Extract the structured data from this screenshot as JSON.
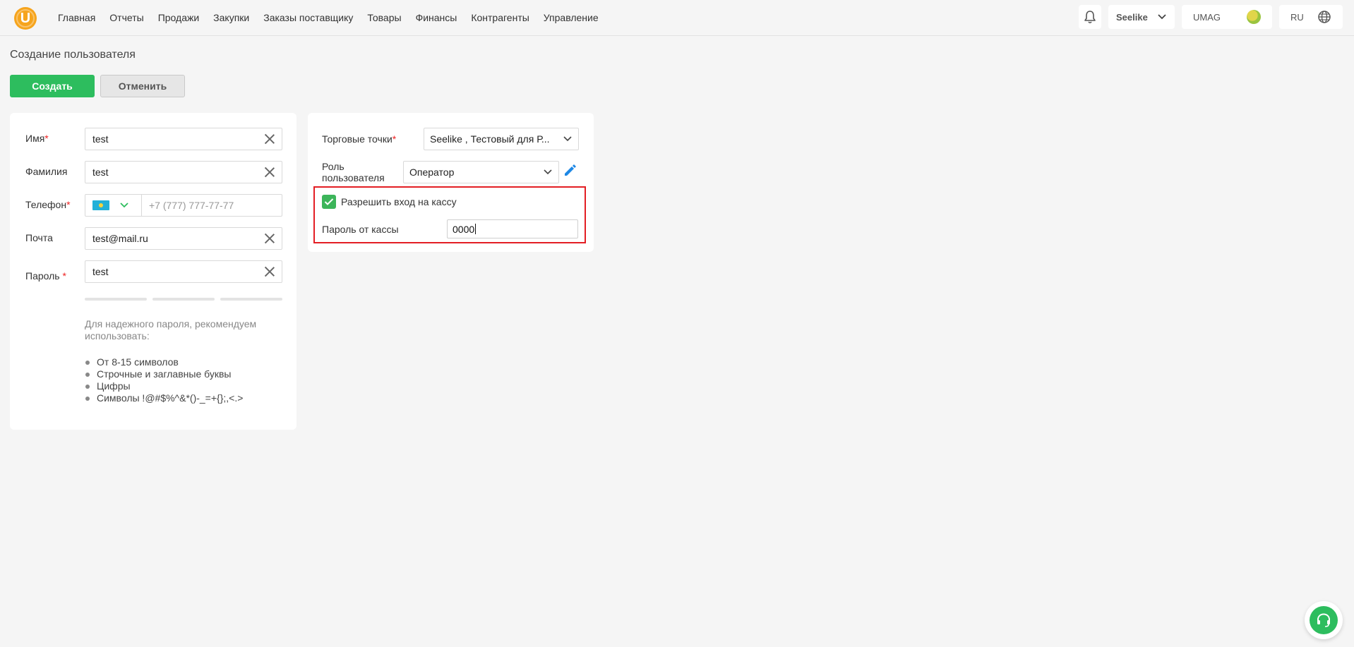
{
  "header": {
    "logo_letter": "U",
    "nav": [
      "Главная",
      "Отчеты",
      "Продажи",
      "Закупки",
      "Заказы поставщику",
      "Товары",
      "Финансы",
      "Контрагенты",
      "Управление"
    ],
    "org_name": "Seelike",
    "account_name": "UMAG",
    "language": "RU"
  },
  "page": {
    "title": "Создание пользователя",
    "create_label": "Создать",
    "cancel_label": "Отменить"
  },
  "form": {
    "name_label": "Имя",
    "name_value": "test",
    "surname_label": "Фамилия",
    "surname_value": "test",
    "phone_label": "Телефон",
    "phone_placeholder": "+7 (777) 777-77-77",
    "email_label": "Почта",
    "email_value": "test@mail.ru",
    "password_label": "Пароль",
    "password_value": "test",
    "required_mark": "*",
    "password_hint": "Для надежного пароля, рекомендуем использовать:",
    "password_rules": [
      "От 8-15 символов",
      "Строчные и заглавные буквы",
      "Цифры",
      "Символы !@#$%^&*()-_=+{};,<.>"
    ]
  },
  "settings": {
    "stores_label": "Торговые точки",
    "stores_value": "Seelike , Тестовый для Р...",
    "role_label_line1": "Роль",
    "role_label_line2": "пользователя",
    "role_value": "Оператор",
    "allow_kassa_label": "Разрешить вход на кассу",
    "allow_kassa_checked": true,
    "kassa_password_label": "Пароль от кассы",
    "kassa_password_value": "0000"
  },
  "colors": {
    "accent_green": "#2dbd5e",
    "logo_orange": "#f6a41c",
    "edit_blue": "#1e88e5",
    "highlight_red": "#e31e24",
    "required_red": "#e22222"
  },
  "icons": [
    "bell-icon",
    "chevron-down-icon",
    "globe-icon",
    "close-icon",
    "pencil-icon",
    "check-icon",
    "headset-icon"
  ]
}
